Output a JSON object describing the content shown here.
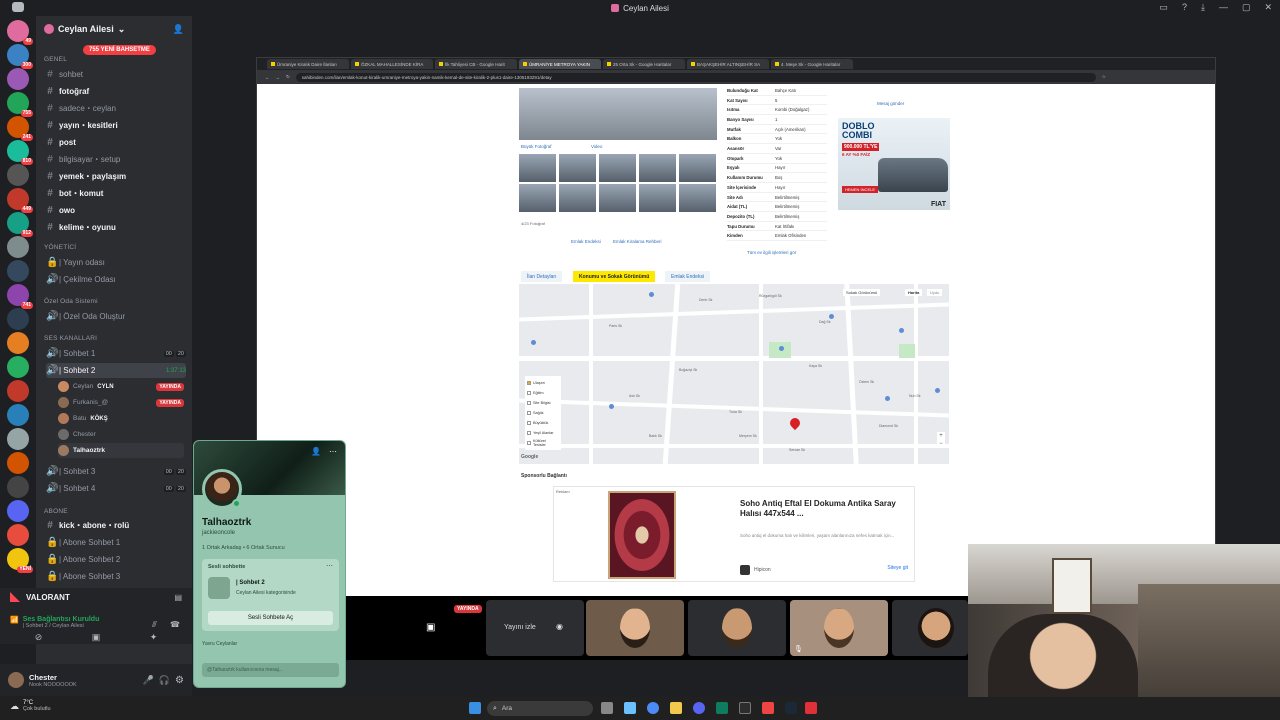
{
  "window": {
    "title": "Ceylan Ailesi"
  },
  "server": {
    "name": "Ceylan Ailesi",
    "new_messages_pill": "755 YENİ BAHSETME"
  },
  "rail_counts": [
    "49",
    "300",
    "",
    "755",
    "241",
    "810",
    "",
    "449",
    "912",
    "",
    "",
    "741",
    "",
    "",
    "",
    "",
    "",
    "",
    "",
    "",
    "",
    "",
    "YENİ"
  ],
  "categories": {
    "genel": "GENEL",
    "yonetici": "YÖNETİCİ",
    "ozel_oda": "Özel Oda Sistemi",
    "ses": "SES KANALLARI",
    "abone": "ABONE"
  },
  "text_channels": [
    {
      "label": "sohbet",
      "bold": false
    },
    {
      "label": "fotoğraf",
      "bold": true
    },
    {
      "label": "sadece・ceylan",
      "bold": false
    },
    {
      "label": "yayın・kesitleri",
      "bold": true
    },
    {
      "label": "post",
      "bold": true
    },
    {
      "label": "bilgisayar・setup",
      "bold": false
    },
    {
      "label": "yemek・paylaşım",
      "bold": true
    },
    {
      "label": "bot・komut",
      "bold": true
    },
    {
      "label": "owo",
      "bold": true
    },
    {
      "label": "kelime・oyunu",
      "bold": true
    }
  ],
  "yonetici_channels": [
    "| Yayın odası",
    "| Çekilme Odası"
  ],
  "ozel_channels": [
    "| Özel Oda Oluştur"
  ],
  "voice_channels": {
    "sohbet1": {
      "label": "| Sohbet 1",
      "a": "00",
      "b": "20"
    },
    "sohbet2": {
      "label": "| Sohbet 2",
      "timer": "1:37:13"
    },
    "sohbet3": {
      "label": "| Sohbet 3",
      "a": "00",
      "b": "20"
    },
    "sohbet4": {
      "label": "| Sohbet 4",
      "a": "00",
      "b": "20"
    }
  },
  "voice_users": [
    {
      "name": "Ceylan",
      "tag": "CYLN",
      "live": "YAYINDA"
    },
    {
      "name": "Furkanis_@",
      "tag": "",
      "live": "YAYINDA"
    },
    {
      "name": "Batu",
      "tag": "KÖKŞ",
      "live": ""
    },
    {
      "name": "Chester",
      "tag": "",
      "live": ""
    },
    {
      "name": "Talhaoztrk",
      "tag": "",
      "live": ""
    }
  ],
  "abone_channels": [
    "kick・abone・rolü",
    "| Abone Sohbet 1",
    "| Abone Sohbet 2",
    "| Abone Sohbet 3"
  ],
  "activity": {
    "game": "VALORANT"
  },
  "voice_status": {
    "title": "Ses Bağlantısı Kuruldu",
    "sub": "| Sohbet 2 / Ceylan Ailesi"
  },
  "user_panel": {
    "name": "Chester",
    "status": "Nook NOOOOOOK"
  },
  "popup": {
    "display_name": "Talhaoztrk",
    "username": "jackieoncole",
    "meta": "1 Ortak Arkadaş • 6 Ortak Sunucu",
    "section": "Sesli sohbette",
    "channel": "| Sohbet 2",
    "channel_sub": "Ceylan Ailesi kategorisinde",
    "join_button": "Sesli Sohbete Aç",
    "note": "Yavru Ceylanlar",
    "message_placeholder": "@Talhaoztrk kullanıcısına mesaj..."
  },
  "browser": {
    "tabs": [
      "Ümraniye Kiralık Daire İlanları",
      "ÖZKAL MAHALLESİNDE KİRA",
      "İlk Tahliyesi CB - Google Harit",
      "ÜMRANİYE METROYA YAKIN",
      "25 Orta Sk - Google Haritalar",
      "BAŞAKŞEHİR ALTINŞEHİR SA",
      "4. Meşe Sk - Google Haritalar"
    ],
    "active_tab": 3,
    "url": "sahibinden.com/ilan/emlak-konut-kiralik-umraniye-metroya-yakin-namik-kemal-de-site-kiralik-2-plus1-daire-1305193291/detay"
  },
  "listing": {
    "photo_links": [
      "Büyük Fotoğraf",
      "Video"
    ],
    "photo_count": "4/23 Fotoğraf",
    "below_links": [
      "Emlak Endeksi",
      "Emlak Kiralama Rehberi"
    ],
    "message_link": "Mesaj gönder",
    "specs": [
      [
        "Bulunduğu Kat",
        "Bahçe Katı"
      ],
      [
        "Kat Sayısı",
        "5"
      ],
      [
        "Isıtma",
        "Kombi (Doğalgaz)"
      ],
      [
        "Banyo Sayısı",
        "1"
      ],
      [
        "Mutfak",
        "Açık (Amerikan)"
      ],
      [
        "Balkon",
        "Yok"
      ],
      [
        "Asansör",
        "Var"
      ],
      [
        "Otopark",
        "Yok"
      ],
      [
        "Eşyalı",
        "Hayır"
      ],
      [
        "Kullanım Durumu",
        "Boş"
      ],
      [
        "Site İçerisinde",
        "Hayır"
      ],
      [
        "Site Adı",
        "Belirtilmemiş"
      ],
      [
        "Aidat (TL)",
        "Belirtilmemiş"
      ],
      [
        "Depozito (TL)",
        "Belirtilmemiş"
      ],
      [
        "Tapu Durumu",
        "Kat İrtifakı"
      ],
      [
        "Kimden",
        "Emlak Ofisinden"
      ]
    ],
    "similar_link": "Tüm ev ilgili işlemleri gör",
    "tabs": [
      "İlan Detayları",
      "Konumu ve Sokak Görünümü",
      "Emlak Endeksi"
    ],
    "active_tab": 1,
    "map_street_btn": "Sokak Görünümü",
    "map_type": [
      "Harita",
      "Uydu"
    ],
    "map_filters": [
      "Ulaşım",
      "Eğitim",
      "Site Bilgisi",
      "Sağlık",
      "Büyüklük",
      "Yeşil Alanlar",
      "Kültürel Tesisler"
    ],
    "map_streets": [
      "Rüzgarlıgöl Sk",
      "Dağ Sk",
      "Boğaziçi Sk",
      "Özlem Sk",
      "Tuna Sk",
      "Sercan Sk",
      "Diamond Sk",
      "Meryem Sk",
      "Paris Sk",
      "Nuh Sk",
      "Balık Sk",
      "Selin Sk",
      "Aslı Sk",
      "Kaya Sk",
      "Derin Sk"
    ],
    "google_label": "Google",
    "sponsored_title": "Sponsorlu Bağlantı",
    "ad": {
      "badge": "Reklam",
      "title": "Soho Antiq Eftal El Dokuma Antika Saray Halısı 447x544 ...",
      "desc": "Soho antiq el dokuma halı ve kilimleri, yaşam alanlarınıza nefes katmak için...",
      "brand": "Hipicon",
      "cta": "Siteye git"
    },
    "side_ad": {
      "title": "DOBLO COMBI",
      "price": "900.000 TL'YE",
      "sub": "6 AY %0 FAİZ",
      "button": "HEMEN İNCELE",
      "brand": "FIAT"
    }
  },
  "stream": {
    "live_badge": "YAYINDA",
    "watch_button": "Yayını izle"
  },
  "taskbar": {
    "weather": "7°C",
    "weather_sub": "Çok bulutlu",
    "search": "Ara"
  },
  "colors": {
    "discord_bg": "#2b2d31",
    "live_red": "#da373c",
    "connected_green": "#23a559",
    "sahibinden_yellow": "#ffe800",
    "popup_green": "#94c5ae"
  }
}
